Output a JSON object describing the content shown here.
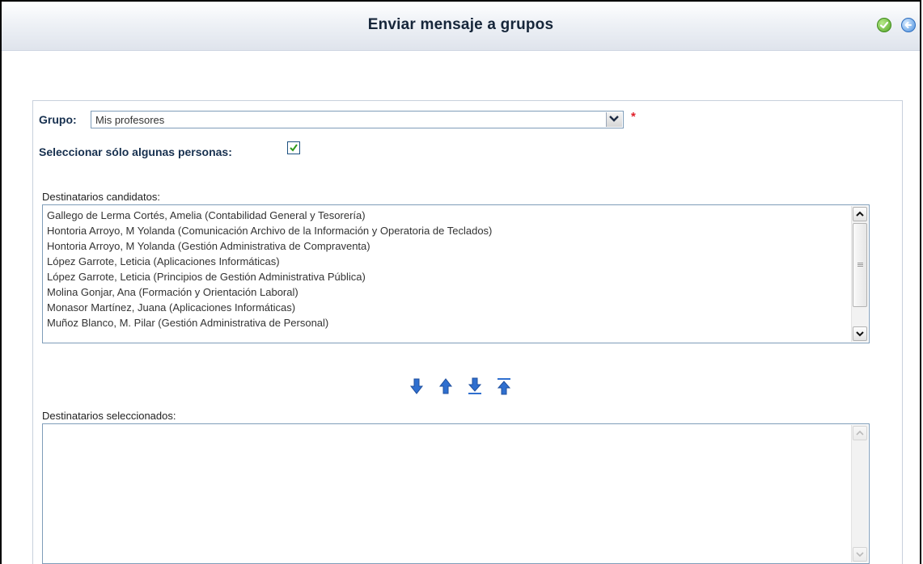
{
  "window": {
    "title": "Enviar mensaje a grupos"
  },
  "toolbar": {
    "ok_icon": "check-circle-icon",
    "back_icon": "back-arrow-circle-icon"
  },
  "form": {
    "grupo_label": "Grupo:",
    "grupo_value": "Mis profesores",
    "required_mark": "*",
    "select_some_label": "Seleccionar sólo algunas personas:",
    "select_some_checked": true
  },
  "candidates": {
    "label": "Destinatarios candidatos:",
    "items": [
      "Gallego de Lerma Cortés, Amelia (Contabilidad General y Tesorería)",
      "Hontoria Arroyo, M Yolanda (Comunicación Archivo de la Información y Operatoria de Teclados)",
      "Hontoria Arroyo, M Yolanda (Gestión Administrativa de Compraventa)",
      "López Garrote, Leticia (Aplicaciones Informáticas)",
      "López Garrote, Leticia (Principios de Gestión Administrativa Pública)",
      "Molina Gonjar, Ana (Formación y Orientación Laboral)",
      "Monasor Martínez, Juana (Aplicaciones Informáticas)",
      "Muñoz Blanco, M. Pilar (Gestión Administrativa de Personal)"
    ]
  },
  "move_buttons": [
    "arrow-down-icon",
    "arrow-up-icon",
    "arrow-down-all-icon",
    "arrow-up-all-icon"
  ],
  "selected": {
    "label": "Destinatarios seleccionados:",
    "items": []
  },
  "colors": {
    "title_text": "#16263a",
    "label_text": "#17304f",
    "arrow_blue": "#2f6fcf",
    "required": "#e0202a"
  }
}
